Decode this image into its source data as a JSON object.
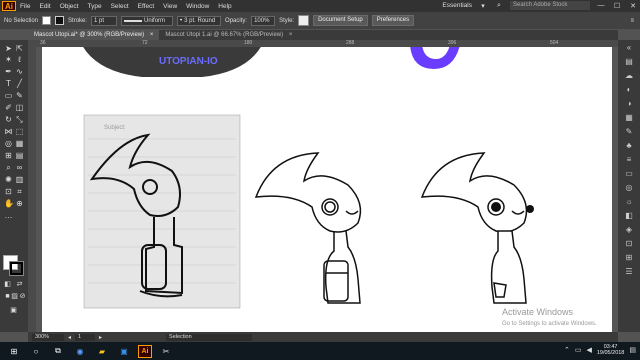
{
  "app": {
    "logo": "Ai",
    "menus": [
      "File",
      "Edit",
      "Object",
      "Type",
      "Select",
      "Effect",
      "View",
      "Window",
      "Help"
    ],
    "workspace": "Essentials",
    "stock_search_placeholder": "Search Adobe Stock",
    "window_buttons": [
      "—",
      "☐",
      "✕"
    ]
  },
  "control_bar": {
    "selection": "No Selection",
    "stroke_label": "Stroke:",
    "stroke_value": "1 pt",
    "profile": "Uniform",
    "brush": "3 pt. Round",
    "opacity_label": "Opacity:",
    "opacity_value": "100%",
    "style_label": "Style:",
    "doc_setup": "Document Setup",
    "preferences": "Preferences"
  },
  "tabs": [
    {
      "label": "Mascot Utopi.ai* @ 300% (RGB/Preview)",
      "close": "×"
    },
    {
      "label": "Mascot Utopi 1.ai @ 66.67% (RGB/Preview)",
      "close": "×"
    }
  ],
  "ruler": {
    "h_numbers": [
      "36",
      "72",
      "108",
      "144",
      "180",
      "216",
      "252",
      "288",
      "324",
      "360",
      "396",
      "432",
      "468",
      "504"
    ]
  },
  "artwork": {
    "banner_text": "UTOPIAN-IO",
    "sketch_note": "Subject:"
  },
  "status_bar": {
    "zoom": "300%",
    "page": "1",
    "mode": "Selection"
  },
  "windows_watermark": {
    "title": "Activate Windows",
    "subtitle": "Go to Settings to activate Windows."
  },
  "taskbar": {
    "time": "03:47",
    "date": "19/05/2018",
    "ai_label": "Ai"
  },
  "colors": {
    "ai_orange": "#ff9a00",
    "ui_dark": "#323232",
    "banner_purple": "#6a3cff"
  }
}
